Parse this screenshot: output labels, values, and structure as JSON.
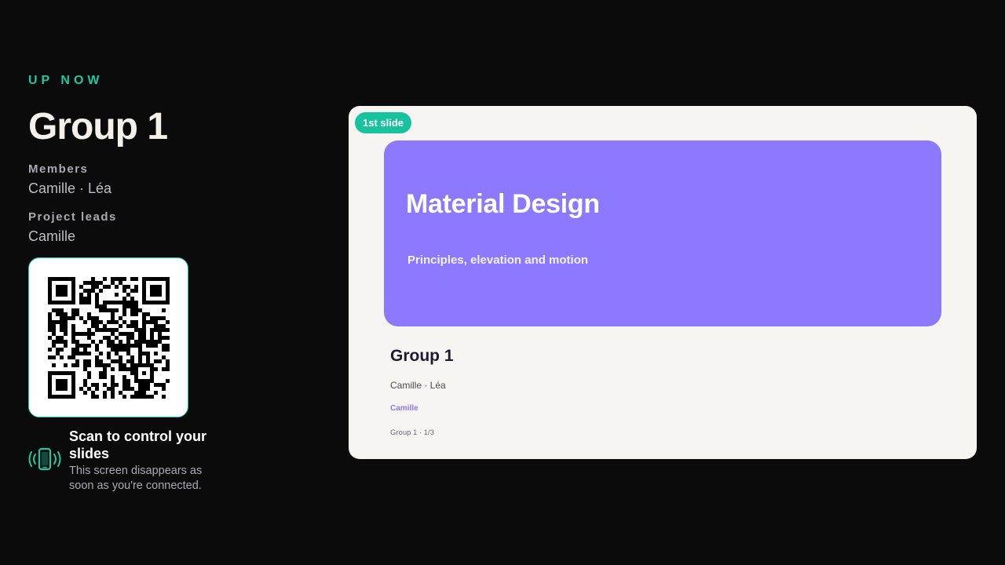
{
  "left_panel": {
    "eyebrow": "UP NOW",
    "group_title": "Group 1",
    "members_label": "Members",
    "members_value": "Camille · Léa",
    "leads_label": "Project leads",
    "leads_value": "Camille",
    "scan_title": "Scan to control your slides",
    "scan_subtitle": "This screen disappears as soon as you're connected.",
    "qr_icon": "qr-code",
    "phone_icon": "phone-vibrate-icon"
  },
  "preview": {
    "badge": "1st slide",
    "hero_title": "Material Design",
    "hero_subtitle": "Principles, elevation and motion",
    "group_title": "Group 1",
    "members": "Camille · Léa",
    "lead": "Camille",
    "footer": "Group 1 · 1/3"
  },
  "colors": {
    "background": "#0b0b0b",
    "accent": "#1fc7a2",
    "hero": "#8c79ff",
    "slide_bg": "#f7f5f1"
  }
}
